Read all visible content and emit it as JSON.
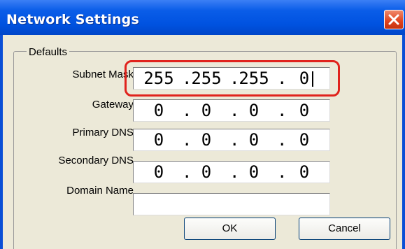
{
  "window": {
    "title": "Network Settings",
    "close_icon": "close-icon"
  },
  "group": {
    "legend": "Defaults"
  },
  "fields": [
    {
      "label": "Subnet Mask",
      "octets": [
        "255",
        "255",
        "255",
        "0"
      ],
      "dot": "."
    },
    {
      "label": "Gateway",
      "octets": [
        "0",
        "0",
        "0",
        "0"
      ],
      "dot": "."
    },
    {
      "label": "Primary DNS",
      "octets": [
        "0",
        "0",
        "0",
        "0"
      ],
      "dot": "."
    },
    {
      "label": "Secondary DNS",
      "octets": [
        "0",
        "0",
        "0",
        "0"
      ],
      "dot": "."
    }
  ],
  "domain": {
    "label": "Domain Name",
    "value": ""
  },
  "buttons": {
    "ok": "OK",
    "cancel": "Cancel"
  },
  "colors": {
    "titlebar": "#0052e0",
    "highlight": "#e0231d",
    "dialog_bg": "#ece9d8"
  }
}
